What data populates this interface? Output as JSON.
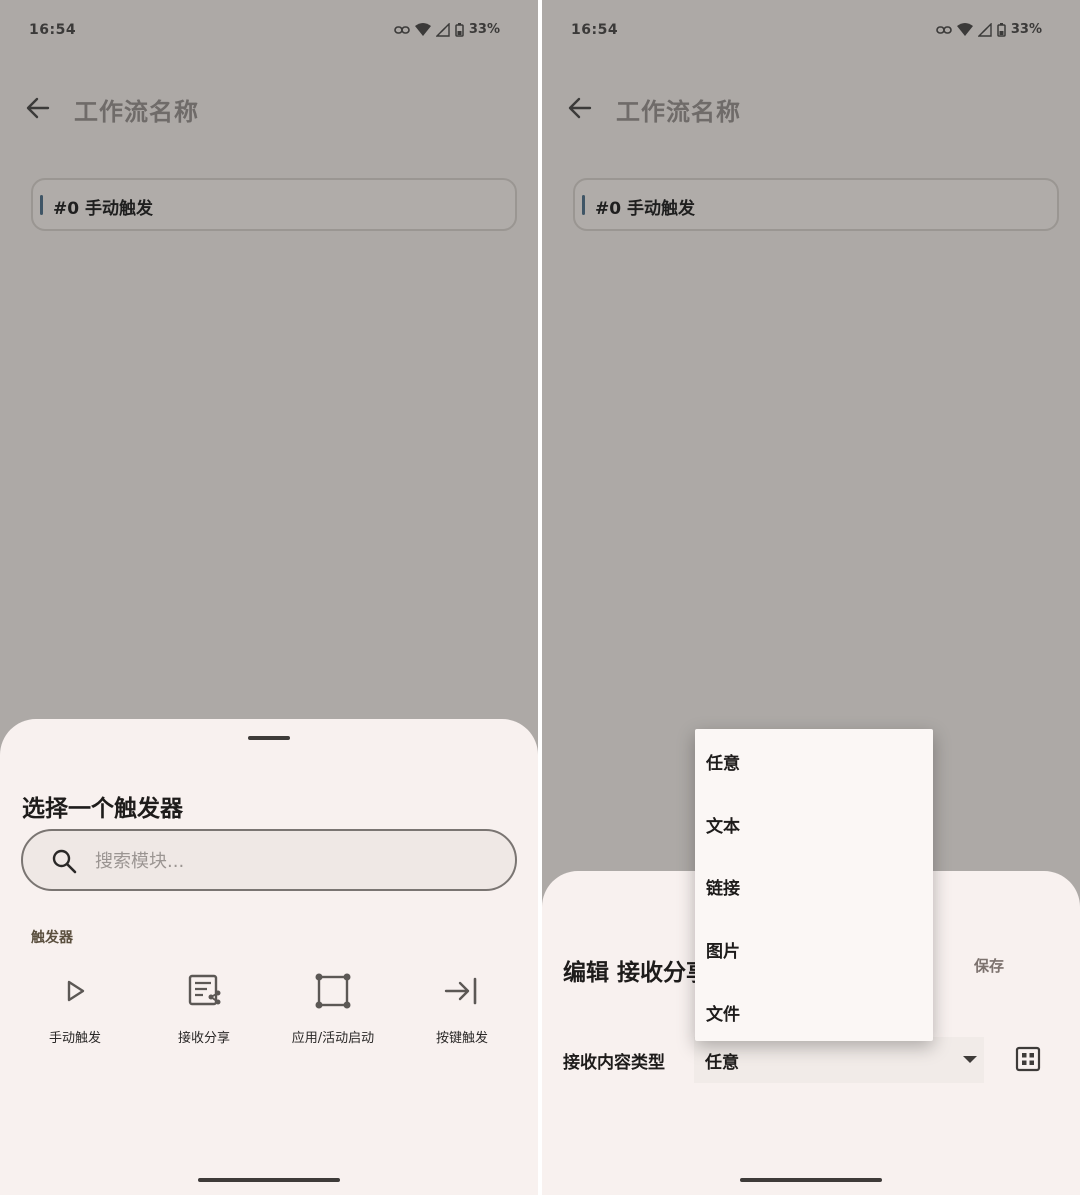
{
  "status_bar": {
    "time": "16:54",
    "battery": "33%"
  },
  "app_bar": {
    "title": "工作流名称"
  },
  "workflow": {
    "trigger_label": "#0 手动触发"
  },
  "left_sheet": {
    "title": "选择一个触发器",
    "search_placeholder": "搜索模块...",
    "section_label": "触发器",
    "triggers": [
      {
        "label": "手动触发",
        "icon": "play-icon"
      },
      {
        "label": "接收分享",
        "icon": "share-receive-icon"
      },
      {
        "label": "应用/活动启动",
        "icon": "app-frame-icon"
      },
      {
        "label": "按键触发",
        "icon": "key-trigger-icon"
      }
    ]
  },
  "right_sheet": {
    "title": "编辑 接收分享",
    "save_label": "保存",
    "field_label": "接收内容类型",
    "selected_value": "任意",
    "options": [
      "任意",
      "文本",
      "链接",
      "图片",
      "文件"
    ]
  }
}
